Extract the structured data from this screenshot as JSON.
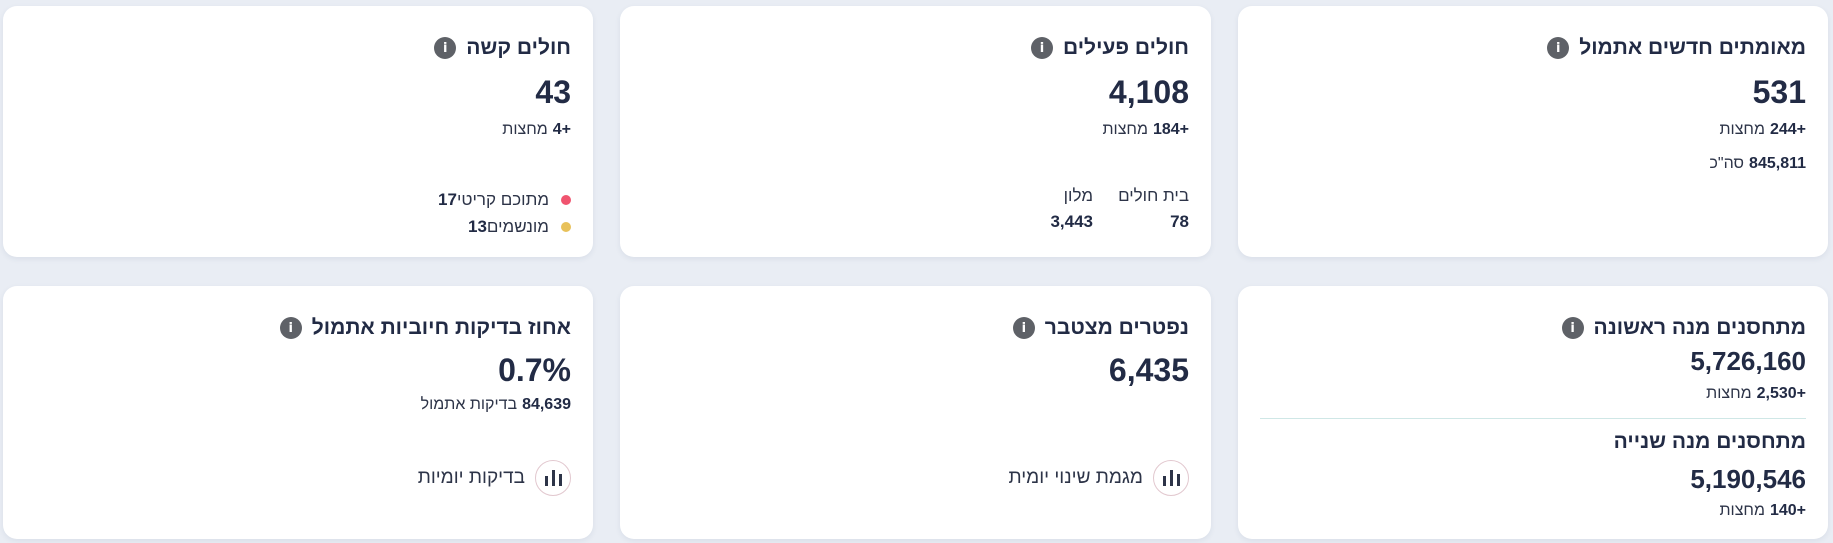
{
  "cards": {
    "new_confirmed": {
      "title": "מאומתים חדשים אתמול",
      "value": "531",
      "change_value": "244+",
      "change_label": "מחצות",
      "total_value": "845,811",
      "total_label": "סה\"כ"
    },
    "active": {
      "title": "חולים פעילים",
      "value": "4,108",
      "change_value": "184+",
      "change_label": "מחצות",
      "hospital_label": "בית חולים",
      "hospital_value": "78",
      "hotel_label": "מלון",
      "hotel_value": "3,443"
    },
    "severe": {
      "title": "חולים קשה",
      "value": "43",
      "change_value": "4+",
      "change_label": "מחצות",
      "critical_label": "מתוכם קריטי",
      "critical_value": "17",
      "ventilated_label": "מונשמים",
      "ventilated_value": "13"
    },
    "vaccinated": {
      "first_title": "מתחסנים מנה ראשונה",
      "first_value": "5,726,160",
      "first_change_value": "2,530+",
      "first_change_label": "מחצות",
      "second_title": "מתחסנים מנה שנייה",
      "second_value": "5,190,546",
      "second_change_value": "140+",
      "second_change_label": "מחצות"
    },
    "deaths": {
      "title": "נפטרים מצטבר",
      "value": "6,435",
      "link_label": "מגמת שינוי יומית"
    },
    "positive_rate": {
      "title": "אחוז בדיקות חיוביות אתמול",
      "value": "0.7%",
      "tests_value": "84,639",
      "tests_label": "בדיקות אתמול",
      "link_label": "בדיקות יומיות"
    }
  },
  "info_icon_glyph": "i",
  "colors": {
    "critical_dot": "#f0546f",
    "ventilated_dot": "#e8c15a",
    "title_text": "#222b45"
  }
}
